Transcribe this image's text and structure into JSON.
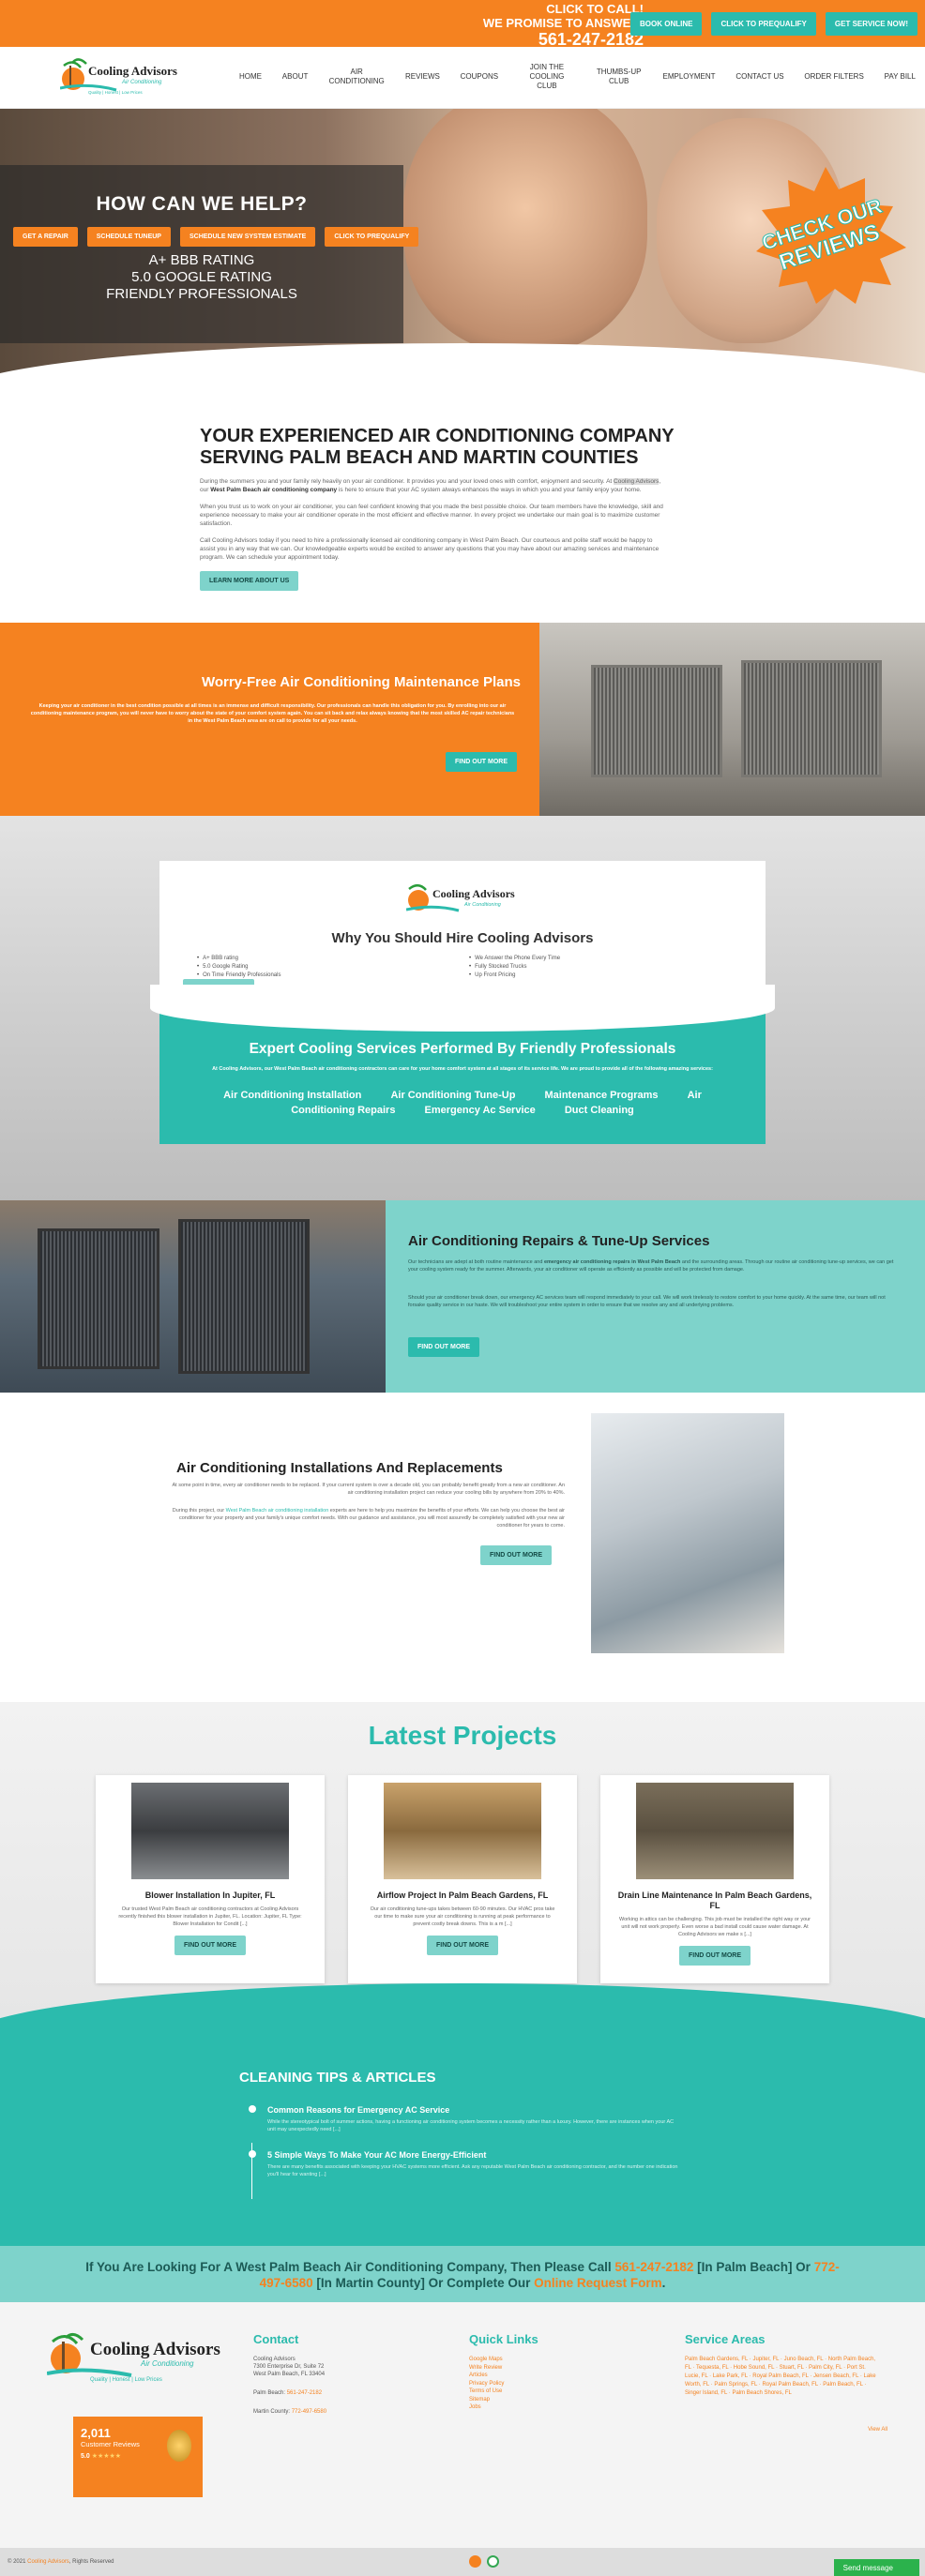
{
  "topbar": {
    "call_line1": "CLICK TO CALL!",
    "call_line2": "WE PROMISE TO ANSWER!",
    "phone": "561-247-2182",
    "buttons": [
      "BOOK ONLINE",
      "CLICK TO PREQUALIFY",
      "GET SERVICE NOW!"
    ]
  },
  "brand": {
    "logo_text": "Cooling Advisors",
    "logo_sub": "Air Conditioning",
    "tagline": "Quality | Honest | Low Prices"
  },
  "nav": [
    "HOME",
    "ABOUT",
    "AIR CONDITIONING",
    "REVIEWS",
    "COUPONS",
    "JOIN THE COOLING CLUB",
    "THUMBS-UP CLUB",
    "EMPLOYMENT",
    "CONTACT US",
    "ORDER FILTERS",
    "PAY BILL"
  ],
  "hero": {
    "title": "HOW CAN WE HELP?",
    "buttons": [
      "GET A REPAIR",
      "SCHEDULE TUNEUP",
      "SCHEDULE NEW SYSTEM ESTIMATE",
      "CLICK TO PREQUALIFY"
    ],
    "ratings": [
      "A+ BBB RATING",
      "5.0 GOOGLE RATING",
      "FRIENDLY PROFESSIONALS"
    ],
    "badge_line1": "CHECK OUR",
    "badge_line2": "REVIEWS"
  },
  "intro": {
    "title": "YOUR EXPERIENCED AIR CONDITIONING COMPANY SERVING PALM BEACH AND MARTIN COUNTIES",
    "p1_a": "During the summers you and your family rely heavily on your air conditioner. It provides you and your loved ones with comfort, enjoyment and security. At ",
    "p1_hl": "Cooling Advisors",
    "p1_b": ", our ",
    "p1_bold": "West Palm Beach air conditioning company",
    "p1_c": " is here to ensure that your AC system always enhances the ways in which you and your family enjoy your home.",
    "p2": "When you trust us to work on your air conditioner, you can feel confident knowing that you made the best possible choice. Our team members have the knowledge, skill and experience necessary to make your air conditioner operate in the most efficient and effective manner. In every project we undertake our main goal is to maximize customer satisfaction.",
    "p3": "Call Cooling Advisors today if you need to hire a professionally licensed air conditioning company in West Palm Beach. Our courteous and polite staff would be happy to assist you in any way that we can. Our knowledgeable experts would be excited to answer any questions that you may have about our amazing services and maintenance program. We can schedule your appointment today.",
    "button": "LEARN MORE ABOUT US"
  },
  "maintenance": {
    "title": "Worry-Free Air Conditioning Maintenance Plans",
    "text": "Keeping your air conditioner in the best condition possible at all times is an immense and difficult responsibility. Our professionals can handle this obligation for you. By enrolling into our air conditioning maintenance program, you will never have to worry about the state of your comfort system again. You can sit back and relax always knowing that the most skilled AC repair technicians in the West Palm Beach area are on call to provide for all your needs.",
    "button": "FIND OUT MORE"
  },
  "why": {
    "title": "Why You Should Hire Cooling Advisors",
    "left_list": [
      "A+ BBB rating",
      "5.0 Google Rating",
      "On Time Friendly Professionals"
    ],
    "right_list": [
      "We Answer the Phone Every Time",
      "Fully Stocked Trucks",
      "Up Front Pricing"
    ],
    "button": "FIND OUT MORE",
    "expert_title": "Expert Cooling Services Performed By Friendly Professionals",
    "expert_text": "At Cooling Advisors, our West Palm Beach air conditioning contractors can care for your home comfort system at all stages of its service life. We are proud to provide all of the following amazing services:",
    "services_row1": [
      "Air Conditioning Installation",
      "Air Conditioning Tune-Up",
      "Maintenance Programs",
      "Air"
    ],
    "services_row2": [
      "Conditioning Repairs",
      "Emergency Ac Service",
      "Duct Cleaning"
    ]
  },
  "repairs": {
    "title": "Air Conditioning Repairs & Tune-Up Services",
    "p1_a": "Our technicians are adept at both routine maintenance and ",
    "p1_bold": "emergency air conditioning repairs in West Palm Beach",
    "p1_b": " and the surrounding areas. Through our routine air conditioning tune-up services, we can get your cooling system ready for the summer. Afterwards, your air conditioner will operate as efficiently as possible and will be protected from damage.",
    "p2": "Should your air conditioner break down, our emergency AC services team will respond immediately to your call. We will work tirelessly to restore comfort to your home quickly. At the same time, our team will not forsake quality service in our haste. We will troubleshoot your entire system in order to ensure that we resolve any and all underlying problems.",
    "button": "FIND OUT MORE"
  },
  "install": {
    "title": "Air Conditioning Installations And Replacements",
    "p1": "At some point in time, every air conditioner needs to be replaced. If your current system is over a decade old, you can probably benefit greatly from a new air conditioner. An air conditioning installation project can reduce your cooling bills by anywhere from 20% to 40%.",
    "p2_a": "During this project, our ",
    "p2_link": "West Palm Beach air conditioning installation",
    "p2_b": " experts are here to help you maximize the benefits of your efforts. We can help you choose the best air conditioner for your property and your family's unique comfort needs. With our guidance and assistance, you will most assuredly be completely satisfied with your new air conditioner for years to come.",
    "button": "FIND OUT MORE"
  },
  "projects": {
    "title": "Latest Projects",
    "items": [
      {
        "title": "Blower Installation In Jupiter, FL",
        "text": "Our trusted West Palm Beach air conditioning contractors at Cooling Advisors recently finished this blower installation in Jupiter, FL. Location: Jupiter, FL Type: Blower Installation for Condit [...]",
        "button": "FIND OUT MORE"
      },
      {
        "title": "Airflow Project In Palm Beach Gardens, FL",
        "text": "Our air conditioning tune-ups takes between 60-90 minutes. Our HVAC pros take our time to make sure your air conditioning is running at peak performance to prevent costly break downs. This is a m [...]",
        "button": "FIND OUT MORE"
      },
      {
        "title": "Drain Line Maintenance In Palm Beach Gardens, FL",
        "text": "Working in attics can be challenging. This job must be installed the right way or your unit will not work properly. Even worse a bad install could cause water damage. At Cooling Advisors we make s [...]",
        "button": "FIND OUT MORE"
      }
    ]
  },
  "tips": {
    "title": "CLEANING TIPS & ARTICLES",
    "items": [
      {
        "title": "Common Reasons for Emergency AC Service",
        "text": "While the stereotypical bolt of summer actions, having a functioning air conditioning system becomes a necessity rather than a luxury. However, there are instances when your AC unit may unexpectedly need [...]"
      },
      {
        "title": "5 Simple Ways To Make Your AC More Energy-Efficient",
        "text": "There are many benefits associated with keeping your HVAC systems more efficient. Ask any reputable West Palm Beach air conditioning contractor, and the number one indication you'll hear for wanting [...]"
      }
    ]
  },
  "cta": {
    "a": "If You Are Looking For A West Palm Beach Air Conditioning Company, Then Please Call ",
    "phone1": "561-247-2182",
    "b": " [In Palm Beach] Or ",
    "phone2": "772-497-6580",
    "c": " [In Martin County] Or Complete Our ",
    "link": "Online Request Form",
    "d": "."
  },
  "footer": {
    "reviews_count": "2,011",
    "reviews_label": "Customer Reviews",
    "reviews_score": "5.0",
    "reviews_stars": "★★★★★",
    "contact_title": "Contact",
    "contact_name": "Cooling Advisors",
    "contact_addr1": "7300 Enterprise Dr, Suite 72",
    "contact_addr2": "West Palm Beach, FL 33404",
    "palm_label": "Palm Beach: ",
    "palm_phone": "561-247-2182",
    "martin_label": "Martin County: ",
    "martin_phone": "772-497-6580",
    "quick_title": "Quick Links",
    "quick_links": [
      "Google Maps",
      "Write Review",
      "Articles",
      "Privacy Policy",
      "Terms of Use",
      "Sitemap",
      "Jobs"
    ],
    "areas_title": "Service Areas",
    "areas_text": "Palm Beach Gardens, FL · Jupiter, FL · Juno Beach, FL · North Palm Beach, FL · Tequesta, FL · Hobe Sound, FL · Stuart, FL · Palm City, FL · Port St. Lucie, FL · Lake Park, FL · Royal Palm Beach, FL · Jensen Beach, FL · Lake Worth, FL · Palm Springs, FL · Royal Palm Beach, FL · Palm Beach, FL · Singer Island, FL · Palm Beach Shores, FL",
    "view_all": "View All"
  },
  "bottom": {
    "copyright_a": "© 2021 ",
    "copyright_link": "Cooling Advisors",
    "copyright_b": ", Rights Reserved",
    "send_message": "Send message"
  },
  "colors": {
    "orange": "#f58220",
    "teal": "#2bbbad",
    "light_teal": "#7ed3cb"
  }
}
